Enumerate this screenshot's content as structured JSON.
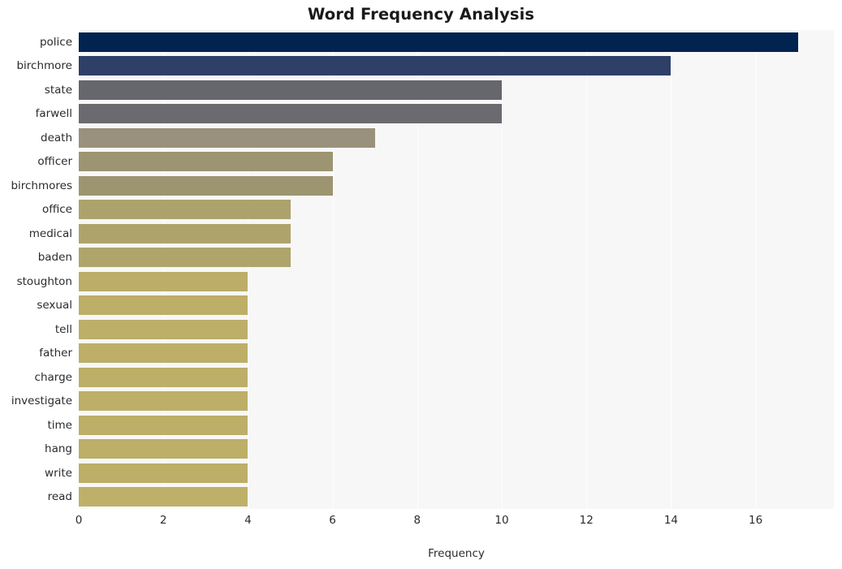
{
  "chart_data": {
    "type": "bar",
    "orientation": "horizontal",
    "title": "Word Frequency Analysis",
    "xlabel": "Frequency",
    "ylabel": "",
    "categories": [
      "police",
      "birchmore",
      "state",
      "farwell",
      "death",
      "officer",
      "birchmores",
      "office",
      "medical",
      "baden",
      "stoughton",
      "sexual",
      "tell",
      "father",
      "charge",
      "investigate",
      "time",
      "hang",
      "write",
      "read"
    ],
    "values": [
      17,
      14,
      10,
      10,
      7,
      6,
      6,
      5,
      5,
      5,
      4,
      4,
      4,
      4,
      4,
      4,
      4,
      4,
      4,
      4
    ],
    "bar_colors": [
      "#00234f",
      "#2e3f68",
      "#66666d",
      "#6b6a6f",
      "#99917c",
      "#9d9471",
      "#9d9470",
      "#aca36c",
      "#aea46b",
      "#afa56b",
      "#bcad68",
      "#bdae68",
      "#bdae68",
      "#bdae68",
      "#bdae68",
      "#bdae68",
      "#bdae68",
      "#bdae68",
      "#bdae68",
      "#bfb069"
    ],
    "xticks": [
      0,
      2,
      4,
      6,
      8,
      10,
      12,
      14,
      16
    ],
    "xtick_labels": [
      "0",
      "2",
      "4",
      "6",
      "8",
      "10",
      "12",
      "14",
      "16"
    ],
    "xlim": [
      0,
      17.85
    ],
    "grid": true,
    "grid_axis": "x",
    "grid_color": "#ffffff",
    "plot_background": "#f7f7f7",
    "figure_background": "#ffffff",
    "legend": null
  }
}
